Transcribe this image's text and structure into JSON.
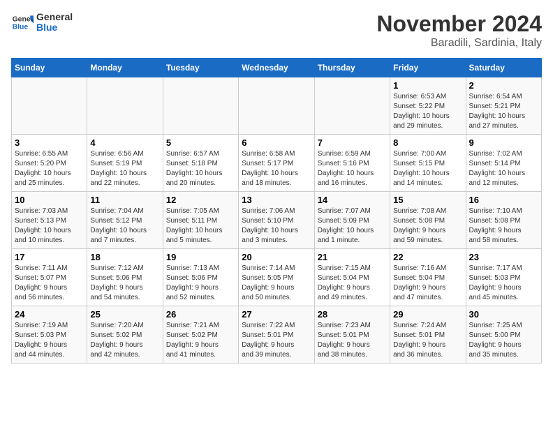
{
  "logo": {
    "line1": "General",
    "line2": "Blue"
  },
  "title": "November 2024",
  "location": "Baradili, Sardinia, Italy",
  "weekdays": [
    "Sunday",
    "Monday",
    "Tuesday",
    "Wednesday",
    "Thursday",
    "Friday",
    "Saturday"
  ],
  "days": [
    {
      "num": "",
      "info": ""
    },
    {
      "num": "",
      "info": ""
    },
    {
      "num": "",
      "info": ""
    },
    {
      "num": "",
      "info": ""
    },
    {
      "num": "",
      "info": ""
    },
    {
      "num": "1",
      "info": "Sunrise: 6:53 AM\nSunset: 5:22 PM\nDaylight: 10 hours\nand 29 minutes."
    },
    {
      "num": "2",
      "info": "Sunrise: 6:54 AM\nSunset: 5:21 PM\nDaylight: 10 hours\nand 27 minutes."
    },
    {
      "num": "3",
      "info": "Sunrise: 6:55 AM\nSunset: 5:20 PM\nDaylight: 10 hours\nand 25 minutes."
    },
    {
      "num": "4",
      "info": "Sunrise: 6:56 AM\nSunset: 5:19 PM\nDaylight: 10 hours\nand 22 minutes."
    },
    {
      "num": "5",
      "info": "Sunrise: 6:57 AM\nSunset: 5:18 PM\nDaylight: 10 hours\nand 20 minutes."
    },
    {
      "num": "6",
      "info": "Sunrise: 6:58 AM\nSunset: 5:17 PM\nDaylight: 10 hours\nand 18 minutes."
    },
    {
      "num": "7",
      "info": "Sunrise: 6:59 AM\nSunset: 5:16 PM\nDaylight: 10 hours\nand 16 minutes."
    },
    {
      "num": "8",
      "info": "Sunrise: 7:00 AM\nSunset: 5:15 PM\nDaylight: 10 hours\nand 14 minutes."
    },
    {
      "num": "9",
      "info": "Sunrise: 7:02 AM\nSunset: 5:14 PM\nDaylight: 10 hours\nand 12 minutes."
    },
    {
      "num": "10",
      "info": "Sunrise: 7:03 AM\nSunset: 5:13 PM\nDaylight: 10 hours\nand 10 minutes."
    },
    {
      "num": "11",
      "info": "Sunrise: 7:04 AM\nSunset: 5:12 PM\nDaylight: 10 hours\nand 7 minutes."
    },
    {
      "num": "12",
      "info": "Sunrise: 7:05 AM\nSunset: 5:11 PM\nDaylight: 10 hours\nand 5 minutes."
    },
    {
      "num": "13",
      "info": "Sunrise: 7:06 AM\nSunset: 5:10 PM\nDaylight: 10 hours\nand 3 minutes."
    },
    {
      "num": "14",
      "info": "Sunrise: 7:07 AM\nSunset: 5:09 PM\nDaylight: 10 hours\nand 1 minute."
    },
    {
      "num": "15",
      "info": "Sunrise: 7:08 AM\nSunset: 5:08 PM\nDaylight: 9 hours\nand 59 minutes."
    },
    {
      "num": "16",
      "info": "Sunrise: 7:10 AM\nSunset: 5:08 PM\nDaylight: 9 hours\nand 58 minutes."
    },
    {
      "num": "17",
      "info": "Sunrise: 7:11 AM\nSunset: 5:07 PM\nDaylight: 9 hours\nand 56 minutes."
    },
    {
      "num": "18",
      "info": "Sunrise: 7:12 AM\nSunset: 5:06 PM\nDaylight: 9 hours\nand 54 minutes."
    },
    {
      "num": "19",
      "info": "Sunrise: 7:13 AM\nSunset: 5:06 PM\nDaylight: 9 hours\nand 52 minutes."
    },
    {
      "num": "20",
      "info": "Sunrise: 7:14 AM\nSunset: 5:05 PM\nDaylight: 9 hours\nand 50 minutes."
    },
    {
      "num": "21",
      "info": "Sunrise: 7:15 AM\nSunset: 5:04 PM\nDaylight: 9 hours\nand 49 minutes."
    },
    {
      "num": "22",
      "info": "Sunrise: 7:16 AM\nSunset: 5:04 PM\nDaylight: 9 hours\nand 47 minutes."
    },
    {
      "num": "23",
      "info": "Sunrise: 7:17 AM\nSunset: 5:03 PM\nDaylight: 9 hours\nand 45 minutes."
    },
    {
      "num": "24",
      "info": "Sunrise: 7:19 AM\nSunset: 5:03 PM\nDaylight: 9 hours\nand 44 minutes."
    },
    {
      "num": "25",
      "info": "Sunrise: 7:20 AM\nSunset: 5:02 PM\nDaylight: 9 hours\nand 42 minutes."
    },
    {
      "num": "26",
      "info": "Sunrise: 7:21 AM\nSunset: 5:02 PM\nDaylight: 9 hours\nand 41 minutes."
    },
    {
      "num": "27",
      "info": "Sunrise: 7:22 AM\nSunset: 5:01 PM\nDaylight: 9 hours\nand 39 minutes."
    },
    {
      "num": "28",
      "info": "Sunrise: 7:23 AM\nSunset: 5:01 PM\nDaylight: 9 hours\nand 38 minutes."
    },
    {
      "num": "29",
      "info": "Sunrise: 7:24 AM\nSunset: 5:01 PM\nDaylight: 9 hours\nand 36 minutes."
    },
    {
      "num": "30",
      "info": "Sunrise: 7:25 AM\nSunset: 5:00 PM\nDaylight: 9 hours\nand 35 minutes."
    }
  ]
}
